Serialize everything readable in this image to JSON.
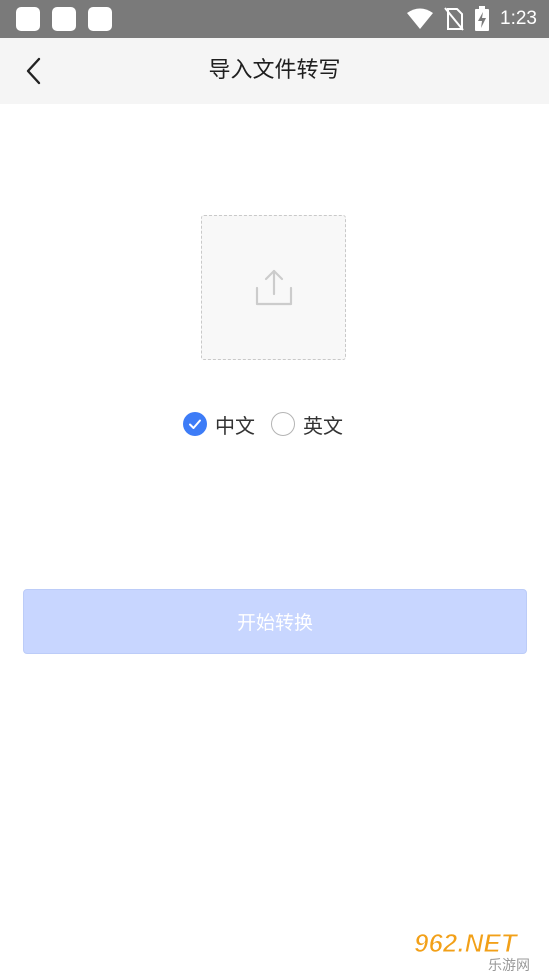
{
  "status_bar": {
    "time": "1:23",
    "icons": [
      "notification-square-icon",
      "notification-square-icon",
      "notification-square-icon",
      "wifi-icon",
      "no-sim-icon",
      "battery-charging-icon"
    ]
  },
  "app_bar": {
    "title": "导入文件转写",
    "back_icon": "chevron-left-icon"
  },
  "upload": {
    "icon": "upload-icon"
  },
  "language": {
    "options": [
      {
        "label": "中文",
        "selected": true
      },
      {
        "label": "英文",
        "selected": false
      }
    ]
  },
  "start_button": {
    "label": "开始转换"
  },
  "watermark": {
    "brand": "962.NET",
    "sub": "乐游网"
  },
  "colors": {
    "status_bar": "#7a7a7a",
    "app_bar": "#f5f5f5",
    "accent": "#3d7cf7",
    "button_disabled": "#c8d6ff"
  }
}
